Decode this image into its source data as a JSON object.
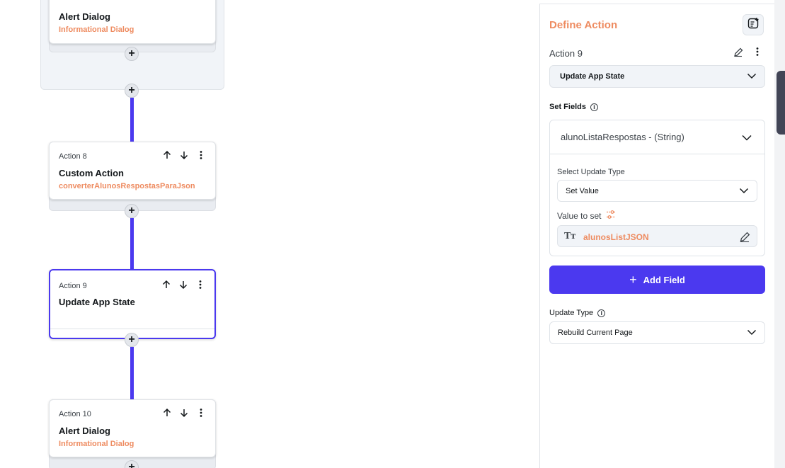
{
  "canvas": {
    "cards": [
      {
        "step": "",
        "title": "Alert Dialog",
        "subtitle": "Informational Dialog"
      },
      {
        "step": "Action 8",
        "title": "Custom Action",
        "subtitle": "converterAlunosRespostasParaJson"
      },
      {
        "step": "Action 9",
        "title": "Update App State",
        "subtitle": ""
      },
      {
        "step": "Action 10",
        "title": "Alert Dialog",
        "subtitle": "Informational Dialog"
      }
    ],
    "add_glyph": "+"
  },
  "panel": {
    "title": "Define Action",
    "action_name": "Action 9",
    "action_type": "Update App State",
    "set_fields_label": "Set Fields",
    "field": {
      "name": "alunoListaRespostas - (String)",
      "select_update_type_label": "Select Update Type",
      "update_type_value": "Set Value",
      "value_to_set_label": "Value to set",
      "value": "alunosListJSON",
      "value_type_glyph": "Tт"
    },
    "add_field_label": "Add Field",
    "update_type_label": "Update Type",
    "update_type_value": "Rebuild Current Page"
  },
  "colors": {
    "accent": "#4b39ef",
    "orange": "#ee8b60"
  }
}
